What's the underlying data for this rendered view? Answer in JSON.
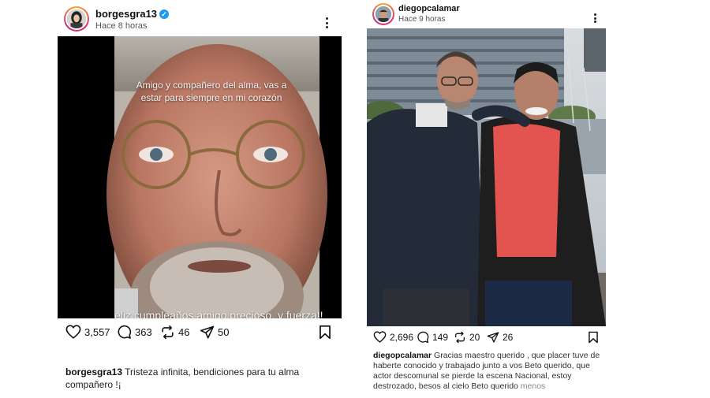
{
  "posts": [
    {
      "username": "borgesgra13",
      "verified": true,
      "time": "Hace 8 horas",
      "overlay_top": "Amigo y compañero del alma, vas a estar para siempre en mi corazón",
      "overlay_bottom": "eliz cumpleaños amigo precioso, y fuerza!!",
      "likes": "3,557",
      "comments": "363",
      "reposts": "46",
      "shares": "50",
      "caption": "Tristeza infinita, bendiciones para tu alma compañero !¡"
    },
    {
      "username": "diegopcalamar",
      "verified": false,
      "time": "Hace 9 horas",
      "likes": "2,696",
      "comments": "149",
      "reposts": "20",
      "shares": "26",
      "caption": "Gracias maestro querido , que placer tuve de haberte conocido y trabajado junto a vos Beto querido, que actor descomunal se pierde la escena Nacional, estoy destrozado, besos al cielo Beto querido",
      "less_label": "menos"
    }
  ],
  "icons": {
    "like": "heart-icon",
    "comment": "comment-icon",
    "repost": "repost-icon",
    "share": "send-icon",
    "save": "bookmark-icon",
    "more": "more-dots-icon"
  },
  "colors": {
    "verified": "#1d9bf0",
    "muted": "#888888"
  }
}
